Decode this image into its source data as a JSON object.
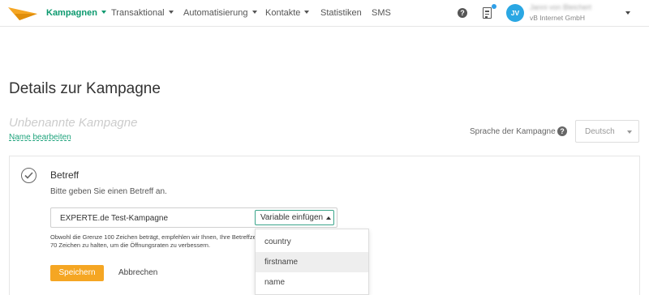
{
  "nav": {
    "items": [
      {
        "label": "Kampagnen",
        "caret": true,
        "active": true
      },
      {
        "label": "Transaktional",
        "caret": true
      },
      {
        "label": "Automatisierung",
        "caret": true
      },
      {
        "label": "Kontakte",
        "caret": true
      },
      {
        "label": "Statistiken",
        "caret": false
      },
      {
        "label": "SMS",
        "caret": false
      }
    ],
    "help_icon": "?",
    "user": {
      "initials": "JV",
      "name": "Janni von Bleichert",
      "company": "vB Internet GmbH"
    }
  },
  "colors": {
    "brand_orange": "#f5a623",
    "active_green": "#0b996e",
    "avatar_blue": "#2aa7e3",
    "link_green": "#1fa37c"
  },
  "page": {
    "title": "Details zur Kampagne",
    "campaign_name_placeholder": "Unbenannte Kampagne",
    "edit_name_link": "Name bearbeiten",
    "language_label": "Sprache der Kampagne",
    "language_help": "?",
    "language_value": "Deutsch"
  },
  "subject": {
    "title": "Betreff",
    "description": "Bitte geben Sie einen Betreff an.",
    "value": "EXPERTE.de Test-Kampagne",
    "variable_button": "Variable einfügen",
    "hint_line1": "Obwohl die Grenze 100 Zeichen beträgt, empfehlen wir Ihnen, Ihre Betreffzeile auf",
    "hint_line2": "70 Zeichen zu halten, um die Öffnungsraten zu verbessern.",
    "save": "Speichern",
    "cancel": "Abbrechen"
  },
  "dropdown": {
    "options": [
      "country",
      "firstname",
      "name"
    ],
    "highlighted": "firstname"
  }
}
